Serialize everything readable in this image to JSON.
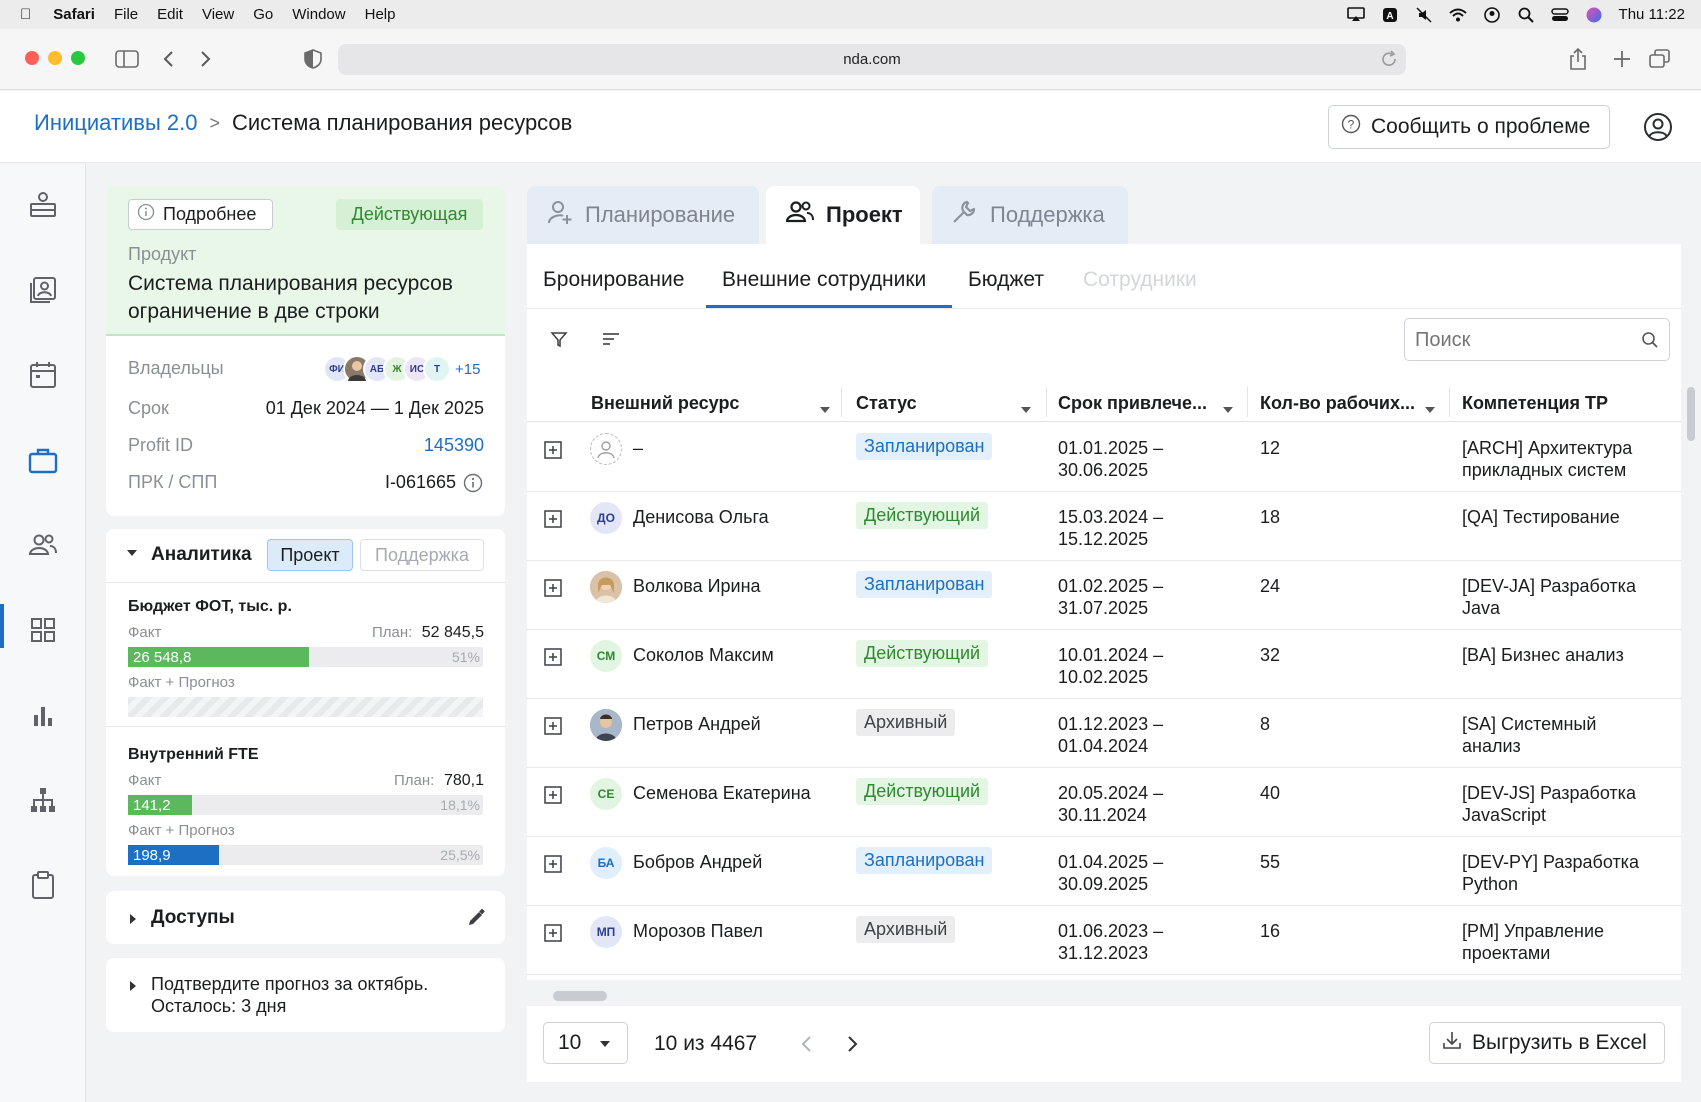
{
  "menubar": {
    "app": "Safari",
    "items": [
      "File",
      "Edit",
      "View",
      "Go",
      "Window",
      "Help"
    ],
    "clock": "Thu 11:22"
  },
  "browser": {
    "url": "nda.com"
  },
  "header": {
    "crumb_root": "Инициативы 2.0",
    "crumb_sep": ">",
    "crumb_current": "Система планирования ресурсов",
    "report_btn": "Сообщить о проблеме"
  },
  "info": {
    "more_btn": "Подробнее",
    "status_badge": "Действующая",
    "product_label": "Продукт",
    "product_name": "Система планирования ресурсов ограничение в две строки",
    "owners_label": "Владельцы",
    "owners_more": "+15",
    "owners_initials": [
      "ФИ",
      "",
      "АБ",
      "Ж",
      "ИС",
      "Т"
    ],
    "term_label": "Срок",
    "term_value": "01 Дек 2024 — 1 Дек 2025",
    "profit_label": "Profit ID",
    "profit_value": "145390",
    "prk_label": "ПРК / СПП",
    "prk_value": "I-061665"
  },
  "analytics": {
    "title": "Аналитика",
    "seg_project": "Проект",
    "seg_support": "Поддержка",
    "budget": {
      "title": "Бюджет ФОТ, тыс. р.",
      "fact_label": "Факт",
      "plan_label": "План:",
      "plan_value": "52 845,5",
      "fact_value": "26 548,8",
      "fact_pct": "51%",
      "fact_ratio": 0.51,
      "forecast_label": "Факт + Прогноз"
    },
    "fte": {
      "title": "Внутренний FTE",
      "fact_label": "Факт",
      "plan_label": "План:",
      "plan_value": "780,1",
      "fact_value": "141,2",
      "fact_pct": "18,1%",
      "fact_ratio": 0.181,
      "forecast_label": "Факт + Прогноз",
      "forecast_value": "198,9",
      "forecast_pct": "25,5%",
      "forecast_ratio": 0.255
    }
  },
  "access": {
    "title": "Доступы"
  },
  "notice": {
    "text_line1": "Подтвердите прогноз за октябрь.",
    "text_line2": "Осталось: 3 дня"
  },
  "tabs": {
    "planning": "Планирование",
    "project": "Проект",
    "support": "Поддержка"
  },
  "subtabs": {
    "booking": "Бронирование",
    "external": "Внешние сотрудники",
    "budget": "Бюджет",
    "employees": "Сотрудники"
  },
  "search": {
    "placeholder": "Поиск"
  },
  "table": {
    "headers": [
      "Внешний ресурс",
      "Статус",
      "Срок привлече...",
      "Кол-во рабочих...",
      "Компетенция ТР"
    ],
    "rows": [
      {
        "initials": "",
        "name": "–",
        "status": "Запланирован",
        "st": "planned",
        "period1": "01.01.2025 –",
        "period2": "30.06.2025",
        "count": "12",
        "comp1": "[ARCH] Архитектура",
        "comp2": "прикладных систем"
      },
      {
        "initials": "ДО",
        "name": "Денисова Ольга",
        "status": "Действующий",
        "st": "active",
        "period1": "15.03.2024 –",
        "period2": "15.12.2025",
        "count": "18",
        "comp1": "[QA] Тестирование",
        "comp2": ""
      },
      {
        "initials": "",
        "name": "Волкова Ирина",
        "status": "Запланирован",
        "st": "planned",
        "period1": "01.02.2025 –",
        "period2": "31.07.2025",
        "count": "24",
        "comp1": "[DEV-JA] Разработка",
        "comp2": "Java"
      },
      {
        "initials": "СМ",
        "name": "Соколов Максим",
        "status": "Действующий",
        "st": "active",
        "period1": "10.01.2024 –",
        "period2": "10.02.2025",
        "count": "32",
        "comp1": "[BA] Бизнес анализ",
        "comp2": ""
      },
      {
        "initials": "",
        "name": "Петров Андрей",
        "status": "Архивный",
        "st": "archive",
        "period1": "01.12.2023 –",
        "period2": "01.04.2024",
        "count": "8",
        "comp1": "[SA] Системный",
        "comp2": "анализ"
      },
      {
        "initials": "СЕ",
        "name": "Семенова Екатерина",
        "status": "Действующий",
        "st": "active",
        "period1": "20.05.2024 –",
        "period2": "30.11.2024",
        "count": "40",
        "comp1": "[DEV-JS] Разработка",
        "comp2": "JavaScript"
      },
      {
        "initials": "БА",
        "name": "Бобров Андрей",
        "status": "Запланирован",
        "st": "planned",
        "period1": "01.04.2025 –",
        "period2": "30.09.2025",
        "count": "55",
        "comp1": "[DEV-PY] Разработка",
        "comp2": "Python"
      },
      {
        "initials": "МП",
        "name": "Морозов Павел",
        "status": "Архивный",
        "st": "archive",
        "period1": "01.06.2023 –",
        "period2": "31.12.2023",
        "count": "16",
        "comp1": "[PM] Управление",
        "comp2": "проектами"
      }
    ]
  },
  "pager": {
    "page_size": "10",
    "summary": "10 из 4467",
    "export_btn": "Выгрузить в Excel"
  },
  "colors": {
    "accent": "#1d6fc4",
    "success": "#2f8a2f",
    "bar_green": "#5cb85c",
    "bar_blue": "#1d6fc4"
  }
}
